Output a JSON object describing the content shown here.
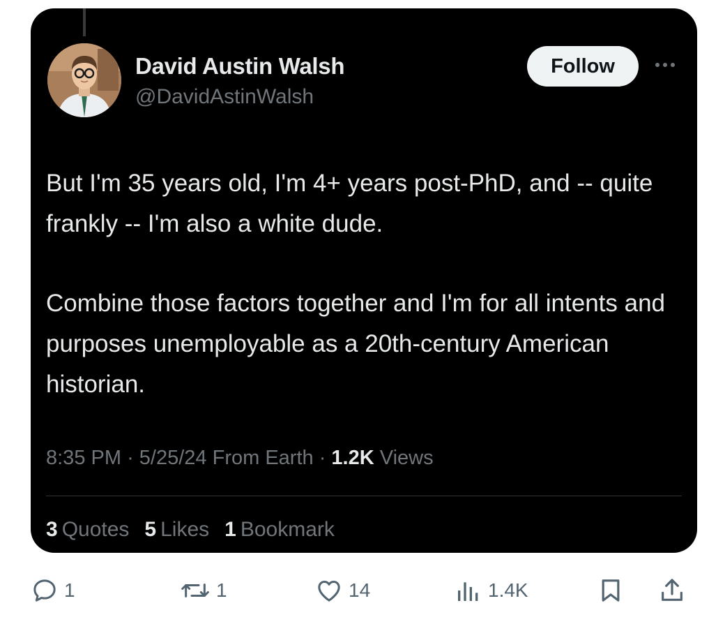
{
  "tweet": {
    "author": {
      "name": "David Austin Walsh",
      "handle": "@DavidAstinWalsh"
    },
    "follow_label": "Follow",
    "text": {
      "paragraph1": "But I'm 35 years old, I'm 4+ years post-PhD, and -- quite frankly -- I'm also a white dude.",
      "paragraph2": "Combine those factors together and I'm for all intents and purposes unemployable as a 20th-century American historian."
    },
    "meta": {
      "time": "8:35 PM",
      "date": "5/25/24",
      "source": "From Earth",
      "views_count": "1.2K",
      "views_label": "Views"
    },
    "stats": {
      "quotes_count": "3",
      "quotes_label": "Quotes",
      "likes_count": "5",
      "likes_label": "Likes",
      "bookmarks_count": "1",
      "bookmarks_label": "Bookmark"
    }
  },
  "actions": {
    "reply_count": "1",
    "repost_count": "1",
    "like_count": "14",
    "views_count": "1.4K"
  },
  "icons": [
    "more-icon",
    "reply-icon",
    "repost-icon",
    "like-icon",
    "views-icon",
    "bookmark-icon",
    "share-icon"
  ],
  "colors": {
    "card_background": "#000000",
    "primary_text": "#e7e9ea",
    "secondary_text": "#71767b",
    "action_icon": "#536471"
  }
}
